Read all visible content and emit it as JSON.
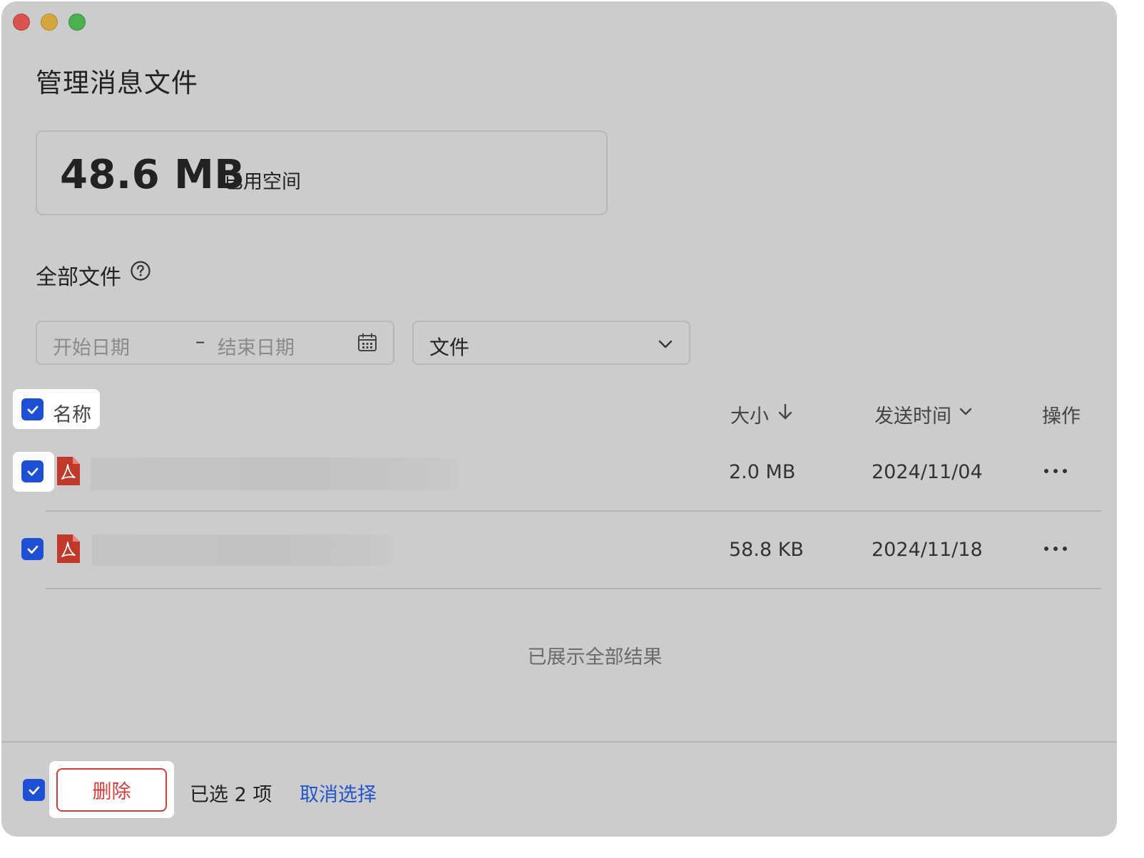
{
  "window": {
    "title": "管理消息文件"
  },
  "storage": {
    "value": "48.6 MB",
    "label": "已用空间"
  },
  "section": {
    "title": "全部文件"
  },
  "filters": {
    "start_placeholder": "开始日期",
    "separator": "–",
    "end_placeholder": "结束日期",
    "type_selected": "文件"
  },
  "table": {
    "headers": {
      "name": "名称",
      "size": "大小",
      "time": "发送时间",
      "actions": "操作"
    },
    "rows": [
      {
        "size": "2.0 MB",
        "date": "2024/11/04",
        "checked": true
      },
      {
        "size": "58.8 KB",
        "date": "2024/11/18",
        "checked": true
      }
    ],
    "end_message": "已展示全部结果"
  },
  "footer": {
    "delete_label": "删除",
    "selected_text": "已选 2 项",
    "deselect_label": "取消选择"
  },
  "colors": {
    "accent": "#1e50d6",
    "danger": "#d93b3b",
    "link": "#2255cc",
    "pdf": "#c0392b"
  }
}
